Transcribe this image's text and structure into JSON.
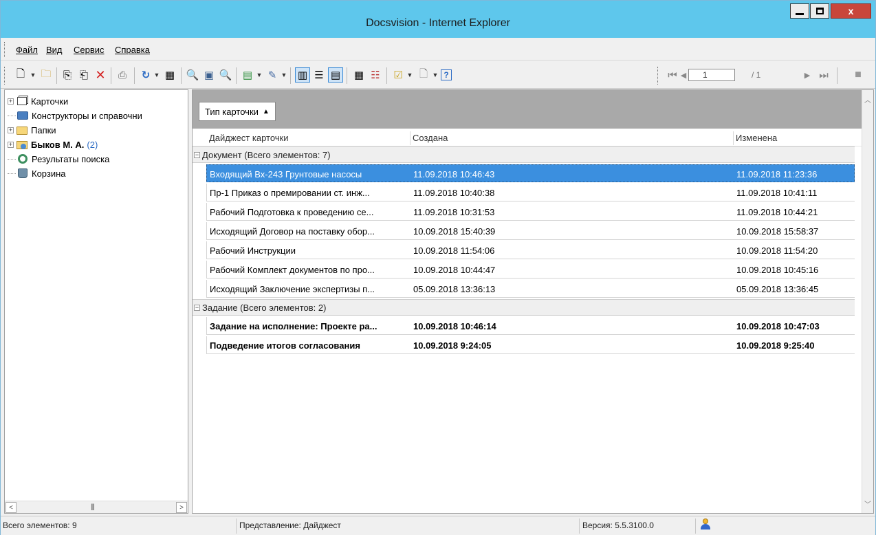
{
  "window": {
    "title": "Docsvision - Internet Explorer",
    "close_label": "x"
  },
  "menu": [
    {
      "label": "Файл"
    },
    {
      "label": "Вид"
    },
    {
      "label": "Сервис"
    },
    {
      "label": "Справка"
    }
  ],
  "toolbar": {
    "icons": [
      "new-card-icon",
      "new-folder-icon",
      "copy-icon",
      "paste-icon",
      "delete-icon",
      "print-icon",
      "refresh-icon",
      "properties-icon",
      "search-icon",
      "view-icon",
      "search-folder-icon",
      "export-icon",
      "tools-icon",
      "view-mode-digest-icon",
      "view-mode-list-icon",
      "view-mode-table-icon",
      "details-icon",
      "report-icon",
      "approve-icon",
      "document-icon",
      "help-icon"
    ],
    "pager": {
      "current_page": "1",
      "total": "/ 1"
    }
  },
  "tree": {
    "items": [
      {
        "label": "Карточки"
      },
      {
        "label": "Конструкторы и справочни"
      },
      {
        "label": "Папки"
      },
      {
        "label": "Быков М. А.",
        "count": "(2)"
      },
      {
        "label": "Результаты поиска"
      },
      {
        "label": "Корзина"
      }
    ]
  },
  "list": {
    "group_by_chip": "Тип карточки",
    "columns": [
      "Дайджест карточки",
      "Создана",
      "Изменена"
    ],
    "groups": [
      {
        "label": "Документ (Всего элементов: 7)",
        "rows": [
          {
            "digest": "Входящий Вх-243 Грунтовые насосы",
            "created": "11.09.2018 10:46:43",
            "modified": "11.09.2018 11:23:36"
          },
          {
            "digest": "Пр-1 Приказ о премировании ст. инж...",
            "created": "11.09.2018 10:40:38",
            "modified": "11.09.2018 10:41:11"
          },
          {
            "digest": "Рабочий Подготовка к проведению се...",
            "created": "11.09.2018 10:31:53",
            "modified": "11.09.2018 10:44:21"
          },
          {
            "digest": "Исходящий Договор на поставку обор...",
            "created": "10.09.2018 15:40:39",
            "modified": "10.09.2018 15:58:37"
          },
          {
            "digest": "Рабочий Инструкции",
            "created": "10.09.2018 11:54:06",
            "modified": "10.09.2018 11:54:20"
          },
          {
            "digest": "Рабочий Комплект документов по про...",
            "created": "10.09.2018 10:44:47",
            "modified": "10.09.2018 10:45:16"
          },
          {
            "digest": "Исходящий Заключение экспертизы п...",
            "created": "05.09.2018 13:36:13",
            "modified": "05.09.2018 13:36:45"
          }
        ]
      },
      {
        "label": "Задание (Всего элементов: 2)",
        "rows": [
          {
            "digest": "Задание на исполнение: Проекте ра...",
            "created": "10.09.2018 10:46:14",
            "modified": "10.09.2018 10:47:03"
          },
          {
            "digest": "Подведение итогов согласования",
            "created": "10.09.2018 9:24:05",
            "modified": "10.09.2018 9:25:40"
          }
        ]
      }
    ]
  },
  "status": {
    "total": "Всего элементов: 9",
    "view": "Представление: Дайджест",
    "version": "Версия: 5.5.3100.0"
  },
  "colors": {
    "titlebar": "#5ec7ec",
    "selection": "#3b8fdf",
    "close_button": "#c9463b",
    "group_bar": "#a9a9a9"
  }
}
